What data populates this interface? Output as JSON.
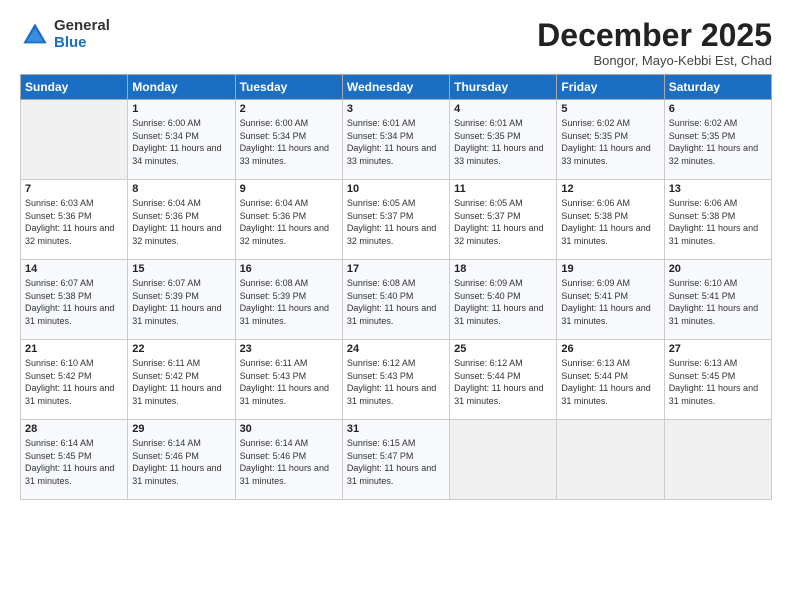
{
  "logo": {
    "general": "General",
    "blue": "Blue"
  },
  "header": {
    "month": "December 2025",
    "location": "Bongor, Mayo-Kebbi Est, Chad"
  },
  "weekdays": [
    "Sunday",
    "Monday",
    "Tuesday",
    "Wednesday",
    "Thursday",
    "Friday",
    "Saturday"
  ],
  "weeks": [
    [
      {
        "day": "",
        "sunrise": "",
        "sunset": "",
        "daylight": ""
      },
      {
        "day": "1",
        "sunrise": "Sunrise: 6:00 AM",
        "sunset": "Sunset: 5:34 PM",
        "daylight": "Daylight: 11 hours and 34 minutes."
      },
      {
        "day": "2",
        "sunrise": "Sunrise: 6:00 AM",
        "sunset": "Sunset: 5:34 PM",
        "daylight": "Daylight: 11 hours and 33 minutes."
      },
      {
        "day": "3",
        "sunrise": "Sunrise: 6:01 AM",
        "sunset": "Sunset: 5:34 PM",
        "daylight": "Daylight: 11 hours and 33 minutes."
      },
      {
        "day": "4",
        "sunrise": "Sunrise: 6:01 AM",
        "sunset": "Sunset: 5:35 PM",
        "daylight": "Daylight: 11 hours and 33 minutes."
      },
      {
        "day": "5",
        "sunrise": "Sunrise: 6:02 AM",
        "sunset": "Sunset: 5:35 PM",
        "daylight": "Daylight: 11 hours and 33 minutes."
      },
      {
        "day": "6",
        "sunrise": "Sunrise: 6:02 AM",
        "sunset": "Sunset: 5:35 PM",
        "daylight": "Daylight: 11 hours and 32 minutes."
      }
    ],
    [
      {
        "day": "7",
        "sunrise": "Sunrise: 6:03 AM",
        "sunset": "Sunset: 5:36 PM",
        "daylight": "Daylight: 11 hours and 32 minutes."
      },
      {
        "day": "8",
        "sunrise": "Sunrise: 6:04 AM",
        "sunset": "Sunset: 5:36 PM",
        "daylight": "Daylight: 11 hours and 32 minutes."
      },
      {
        "day": "9",
        "sunrise": "Sunrise: 6:04 AM",
        "sunset": "Sunset: 5:36 PM",
        "daylight": "Daylight: 11 hours and 32 minutes."
      },
      {
        "day": "10",
        "sunrise": "Sunrise: 6:05 AM",
        "sunset": "Sunset: 5:37 PM",
        "daylight": "Daylight: 11 hours and 32 minutes."
      },
      {
        "day": "11",
        "sunrise": "Sunrise: 6:05 AM",
        "sunset": "Sunset: 5:37 PM",
        "daylight": "Daylight: 11 hours and 32 minutes."
      },
      {
        "day": "12",
        "sunrise": "Sunrise: 6:06 AM",
        "sunset": "Sunset: 5:38 PM",
        "daylight": "Daylight: 11 hours and 31 minutes."
      },
      {
        "day": "13",
        "sunrise": "Sunrise: 6:06 AM",
        "sunset": "Sunset: 5:38 PM",
        "daylight": "Daylight: 11 hours and 31 minutes."
      }
    ],
    [
      {
        "day": "14",
        "sunrise": "Sunrise: 6:07 AM",
        "sunset": "Sunset: 5:38 PM",
        "daylight": "Daylight: 11 hours and 31 minutes."
      },
      {
        "day": "15",
        "sunrise": "Sunrise: 6:07 AM",
        "sunset": "Sunset: 5:39 PM",
        "daylight": "Daylight: 11 hours and 31 minutes."
      },
      {
        "day": "16",
        "sunrise": "Sunrise: 6:08 AM",
        "sunset": "Sunset: 5:39 PM",
        "daylight": "Daylight: 11 hours and 31 minutes."
      },
      {
        "day": "17",
        "sunrise": "Sunrise: 6:08 AM",
        "sunset": "Sunset: 5:40 PM",
        "daylight": "Daylight: 11 hours and 31 minutes."
      },
      {
        "day": "18",
        "sunrise": "Sunrise: 6:09 AM",
        "sunset": "Sunset: 5:40 PM",
        "daylight": "Daylight: 11 hours and 31 minutes."
      },
      {
        "day": "19",
        "sunrise": "Sunrise: 6:09 AM",
        "sunset": "Sunset: 5:41 PM",
        "daylight": "Daylight: 11 hours and 31 minutes."
      },
      {
        "day": "20",
        "sunrise": "Sunrise: 6:10 AM",
        "sunset": "Sunset: 5:41 PM",
        "daylight": "Daylight: 11 hours and 31 minutes."
      }
    ],
    [
      {
        "day": "21",
        "sunrise": "Sunrise: 6:10 AM",
        "sunset": "Sunset: 5:42 PM",
        "daylight": "Daylight: 11 hours and 31 minutes."
      },
      {
        "day": "22",
        "sunrise": "Sunrise: 6:11 AM",
        "sunset": "Sunset: 5:42 PM",
        "daylight": "Daylight: 11 hours and 31 minutes."
      },
      {
        "day": "23",
        "sunrise": "Sunrise: 6:11 AM",
        "sunset": "Sunset: 5:43 PM",
        "daylight": "Daylight: 11 hours and 31 minutes."
      },
      {
        "day": "24",
        "sunrise": "Sunrise: 6:12 AM",
        "sunset": "Sunset: 5:43 PM",
        "daylight": "Daylight: 11 hours and 31 minutes."
      },
      {
        "day": "25",
        "sunrise": "Sunrise: 6:12 AM",
        "sunset": "Sunset: 5:44 PM",
        "daylight": "Daylight: 11 hours and 31 minutes."
      },
      {
        "day": "26",
        "sunrise": "Sunrise: 6:13 AM",
        "sunset": "Sunset: 5:44 PM",
        "daylight": "Daylight: 11 hours and 31 minutes."
      },
      {
        "day": "27",
        "sunrise": "Sunrise: 6:13 AM",
        "sunset": "Sunset: 5:45 PM",
        "daylight": "Daylight: 11 hours and 31 minutes."
      }
    ],
    [
      {
        "day": "28",
        "sunrise": "Sunrise: 6:14 AM",
        "sunset": "Sunset: 5:45 PM",
        "daylight": "Daylight: 11 hours and 31 minutes."
      },
      {
        "day": "29",
        "sunrise": "Sunrise: 6:14 AM",
        "sunset": "Sunset: 5:46 PM",
        "daylight": "Daylight: 11 hours and 31 minutes."
      },
      {
        "day": "30",
        "sunrise": "Sunrise: 6:14 AM",
        "sunset": "Sunset: 5:46 PM",
        "daylight": "Daylight: 11 hours and 31 minutes."
      },
      {
        "day": "31",
        "sunrise": "Sunrise: 6:15 AM",
        "sunset": "Sunset: 5:47 PM",
        "daylight": "Daylight: 11 hours and 31 minutes."
      },
      {
        "day": "",
        "sunrise": "",
        "sunset": "",
        "daylight": ""
      },
      {
        "day": "",
        "sunrise": "",
        "sunset": "",
        "daylight": ""
      },
      {
        "day": "",
        "sunrise": "",
        "sunset": "",
        "daylight": ""
      }
    ]
  ]
}
